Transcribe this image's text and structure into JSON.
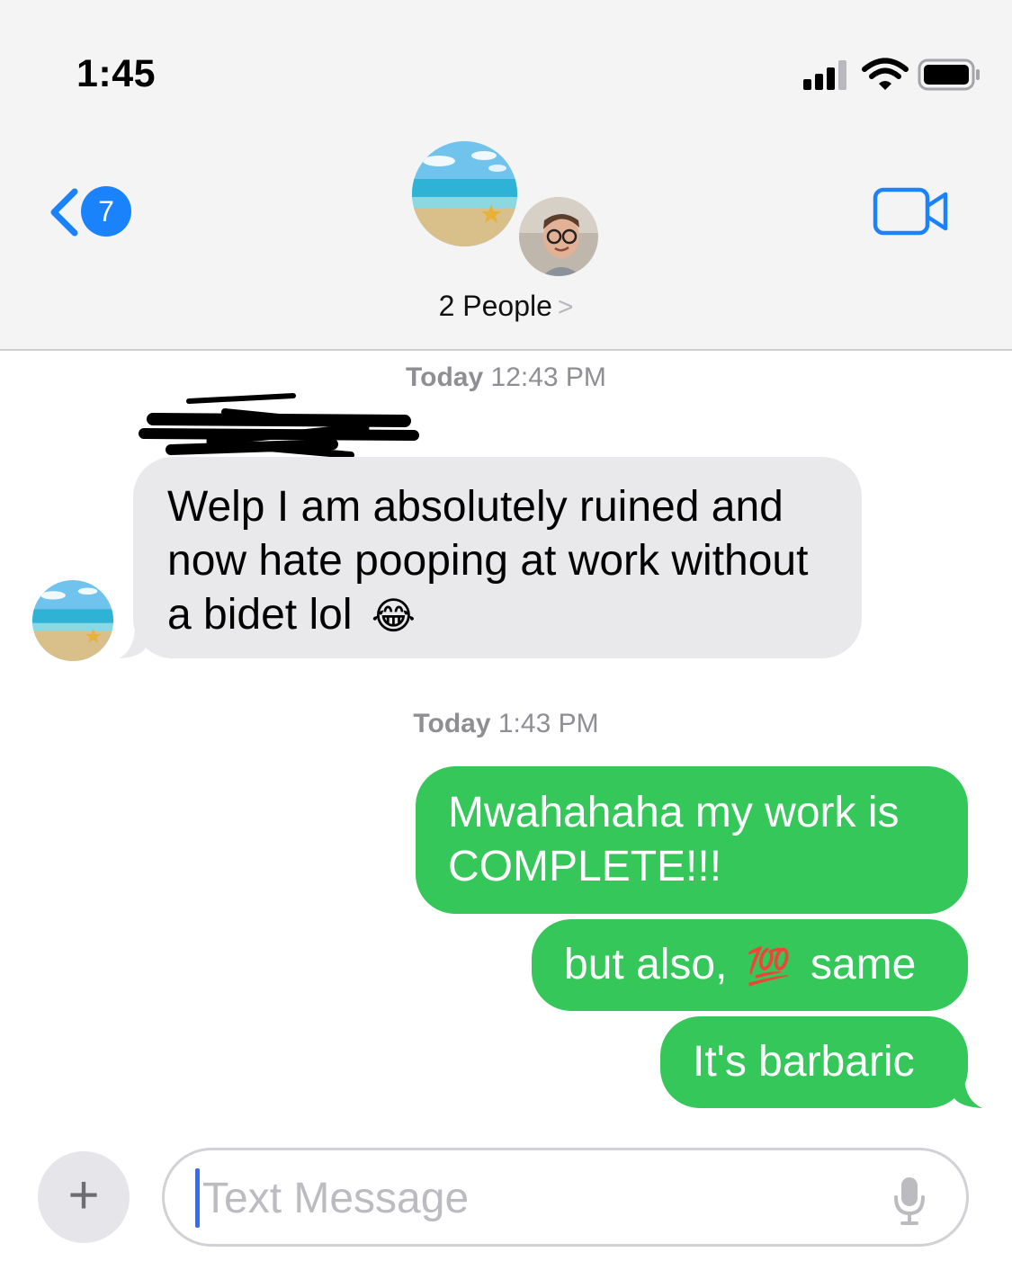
{
  "status_bar": {
    "time": "1:45"
  },
  "nav": {
    "back_badge_count": "7",
    "group_name": "2 People",
    "group_chevron": ">"
  },
  "conversation": {
    "timestamps": [
      {
        "day": "Today",
        "time": "12:43 PM"
      },
      {
        "day": "Today",
        "time": "1:43 PM"
      }
    ],
    "incoming": {
      "text": "Welp I am absolutely ruined and now hate pooping at work without a bidet lol",
      "emoji": "😂"
    },
    "outgoing": [
      {
        "text": "Mwahahaha my work is COMPLETE!!!"
      },
      {
        "text_before": "but also,",
        "emoji": "💯",
        "text_after": "same"
      },
      {
        "text": "It's barbaric"
      }
    ]
  },
  "input": {
    "plus_label": "+",
    "placeholder": "Text Message"
  },
  "colors": {
    "accent_blue": "#1a82fb",
    "outgoing_green": "#35c759",
    "incoming_gray": "#e9e9eb",
    "header_bg": "#f4f4f5"
  },
  "icons": [
    "signal-icon",
    "wifi-icon",
    "battery-icon",
    "back-chevron-icon",
    "video-camera-icon",
    "microphone-icon",
    "plus-icon"
  ]
}
